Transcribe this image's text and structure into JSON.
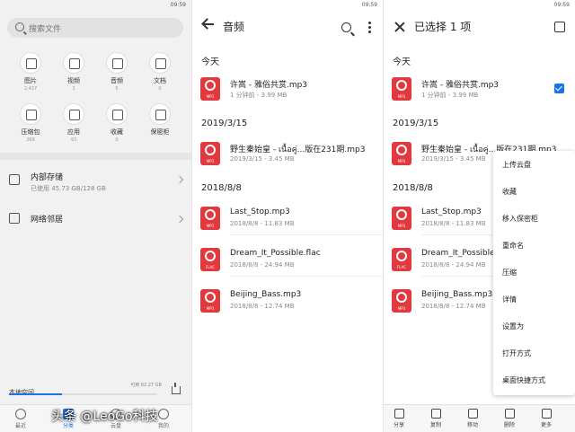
{
  "status": {
    "time": "09:59"
  },
  "left": {
    "search_placeholder": "搜索文件",
    "categories": [
      {
        "label": "图片",
        "count": "2,437",
        "icon": "image-icon"
      },
      {
        "label": "视频",
        "count": "3",
        "icon": "video-icon"
      },
      {
        "label": "音频",
        "count": "5",
        "icon": "audio-icon"
      },
      {
        "label": "文档",
        "count": "0",
        "icon": "document-icon"
      },
      {
        "label": "压缩包",
        "count": "268",
        "icon": "archive-icon"
      },
      {
        "label": "应用",
        "count": "93",
        "icon": "app-icon"
      },
      {
        "label": "收藏",
        "count": "0",
        "icon": "star-icon"
      },
      {
        "label": "保密柜",
        "count": "",
        "icon": "safe-icon"
      }
    ],
    "internal_storage": {
      "title": "内部存储",
      "detail": "已使用 45.73 GB/128 GB"
    },
    "network": {
      "title": "网络邻居"
    },
    "local_space": {
      "label": "本地空间",
      "available": "可用 82.27 GB",
      "used_fraction": 0.36
    },
    "tabs": [
      {
        "label": "最近",
        "icon": "clock-icon",
        "active": false
      },
      {
        "label": "分类",
        "icon": "folder-icon",
        "active": true
      },
      {
        "label": "云盘",
        "icon": "cloud-icon",
        "active": false
      },
      {
        "label": "我的",
        "icon": "person-icon",
        "active": false
      }
    ]
  },
  "middle": {
    "title": "音频",
    "groups": [
      {
        "date": "今天",
        "files": [
          {
            "name": "许嵩 - 雅俗共赏.mp3",
            "meta": "1 分钟前 - 3.99 MB",
            "type": "MP3"
          }
        ]
      },
      {
        "date": "2019/3/15",
        "files": [
          {
            "name": "野生秦始皇 - เนื้อคู่...版在231期.mp3",
            "meta": "2019/3/15 - 3.45 MB",
            "type": "MP3"
          }
        ]
      },
      {
        "date": "2018/8/8",
        "files": [
          {
            "name": "Last_Stop.mp3",
            "meta": "2018/8/8 - 11.83 MB",
            "type": "MP3"
          },
          {
            "name": "Dream_It_Possible.flac",
            "meta": "2018/8/8 - 24.94 MB",
            "type": "FLAC"
          },
          {
            "name": "Beijing_Bass.mp3",
            "meta": "2018/8/8 - 12.74 MB",
            "type": "MP3"
          }
        ]
      }
    ]
  },
  "right": {
    "title": "已选择 1 项",
    "groups": [
      {
        "date": "今天",
        "files": [
          {
            "name": "许嵩 - 雅俗共赏.mp3",
            "meta": "1 分钟前 - 3.99 MB",
            "type": "MP3"
          }
        ]
      },
      {
        "date": "2019/3/15",
        "files": [
          {
            "name": "野生秦始皇 - เนื้อคู่...版在231期.mp3",
            "meta": "2019/3/15 - 3.45 MB",
            "type": "MP3"
          }
        ]
      },
      {
        "date": "2018/8/8",
        "files": [
          {
            "name": "Last_Stop.mp3",
            "meta": "2018/8/8 - 11.83 MB",
            "type": "MP3"
          },
          {
            "name": "Dream_It_Possible",
            "meta": "2018/8/8 - 24.94 MB",
            "type": "FLAC"
          },
          {
            "name": "Beijing_Bass.mp3",
            "meta": "2018/8/8 - 12.74 MB",
            "type": "MP3"
          }
        ]
      }
    ],
    "menu": [
      "上传云盘",
      "收藏",
      "移入保密柜",
      "重命名",
      "压缩",
      "详情",
      "设置为",
      "打开方式",
      "桌面快捷方式"
    ],
    "actions": [
      {
        "label": "分享",
        "icon": "share-icon"
      },
      {
        "label": "复制",
        "icon": "copy-icon"
      },
      {
        "label": "移动",
        "icon": "move-icon"
      },
      {
        "label": "删除",
        "icon": "delete-icon"
      },
      {
        "label": "更多",
        "icon": "more-icon"
      }
    ]
  },
  "watermark": "头条 @LeoGo科技",
  "colors": {
    "accent": "#1a73e8",
    "file_icon": "#e4383f"
  }
}
